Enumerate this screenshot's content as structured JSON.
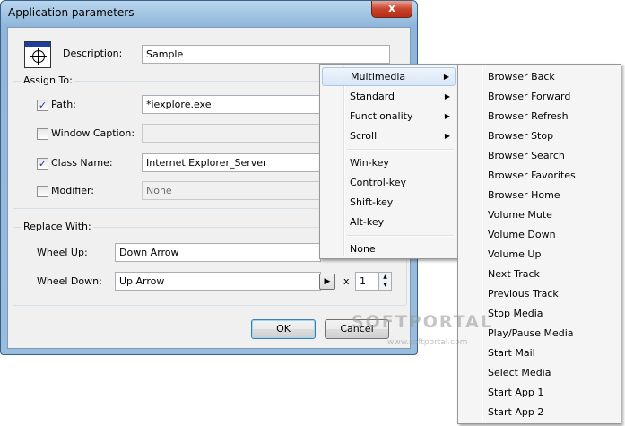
{
  "window": {
    "title": "Application parameters",
    "close_glyph": "x"
  },
  "form": {
    "description_label": "Description:",
    "description_value": "Sample",
    "assign_group": "Assign To:",
    "path_label": "Path:",
    "path_checked": true,
    "path_value": "*iexplore.exe",
    "caption_label": "Window Caption:",
    "caption_checked": false,
    "caption_value": "",
    "classname_label": "Class Name:",
    "classname_checked": true,
    "classname_value": "Internet Explorer_Server",
    "modifier_label": "Modifier:",
    "modifier_checked": false,
    "modifier_value": "None",
    "replace_group": "Replace With:",
    "wheelup_label": "Wheel Up:",
    "wheelup_value": "Down Arrow",
    "wheeldown_label": "Wheel Down:",
    "wheeldown_value": "Up Arrow",
    "times_label": "x",
    "repeat_value": "1"
  },
  "buttons": {
    "ok": "OK",
    "cancel": "Cancel"
  },
  "icons": {
    "check_glyph": "✓",
    "play_glyph": "▶",
    "submenu_glyph": "▶",
    "spin_up": "▲",
    "spin_down": "▼"
  },
  "menu": {
    "items": [
      "Multimedia",
      "Standard",
      "Functionality",
      "Scroll",
      "Win-key",
      "Control-key",
      "Shift-key",
      "Alt-key",
      "None"
    ],
    "highlighted": "Multimedia"
  },
  "submenu": {
    "items": [
      "Browser Back",
      "Browser Forward",
      "Browser Refresh",
      "Browser Stop",
      "Browser Search",
      "Browser Favorites",
      "Browser Home",
      "Volume Mute",
      "Volume Down",
      "Volume Up",
      "Next Track",
      "Previous Track",
      "Stop Media",
      "Play/Pause Media",
      "Start Mail",
      "Select Media",
      "Start App 1",
      "Start App 2"
    ]
  },
  "watermark": {
    "text": "SOFTPORTAL",
    "sub": "www.softportal.com"
  }
}
